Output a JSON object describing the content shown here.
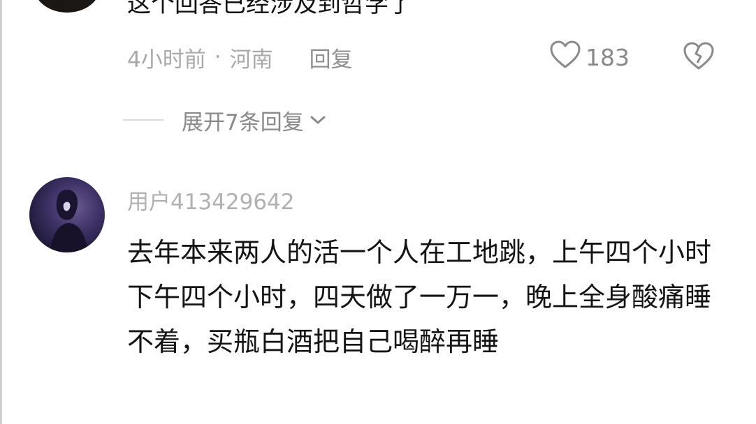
{
  "previous_comment": {
    "text_partial": "这个回答已经涉及到哲学了",
    "time": "4小时前",
    "separator": "·",
    "location": "河南",
    "reply_label": "回复",
    "like_count": "183",
    "expand_replies_label": "展开7条回复"
  },
  "comment": {
    "username": "用户413429642",
    "text": "去年本来两人的活一个人在工地跳，上午四个小时下午四个小时，四天做了一万一，晚上全身酸痛睡不着，买瓶白酒把自己喝醉再睡"
  },
  "icons": {
    "like": "heart-outline-icon",
    "dislike": "broken-heart-icon",
    "expand": "chevron-down-icon"
  },
  "colors": {
    "text_primary": "#141414",
    "text_secondary": "#a9a9a9",
    "icon_gray": "#8a8a8a"
  }
}
